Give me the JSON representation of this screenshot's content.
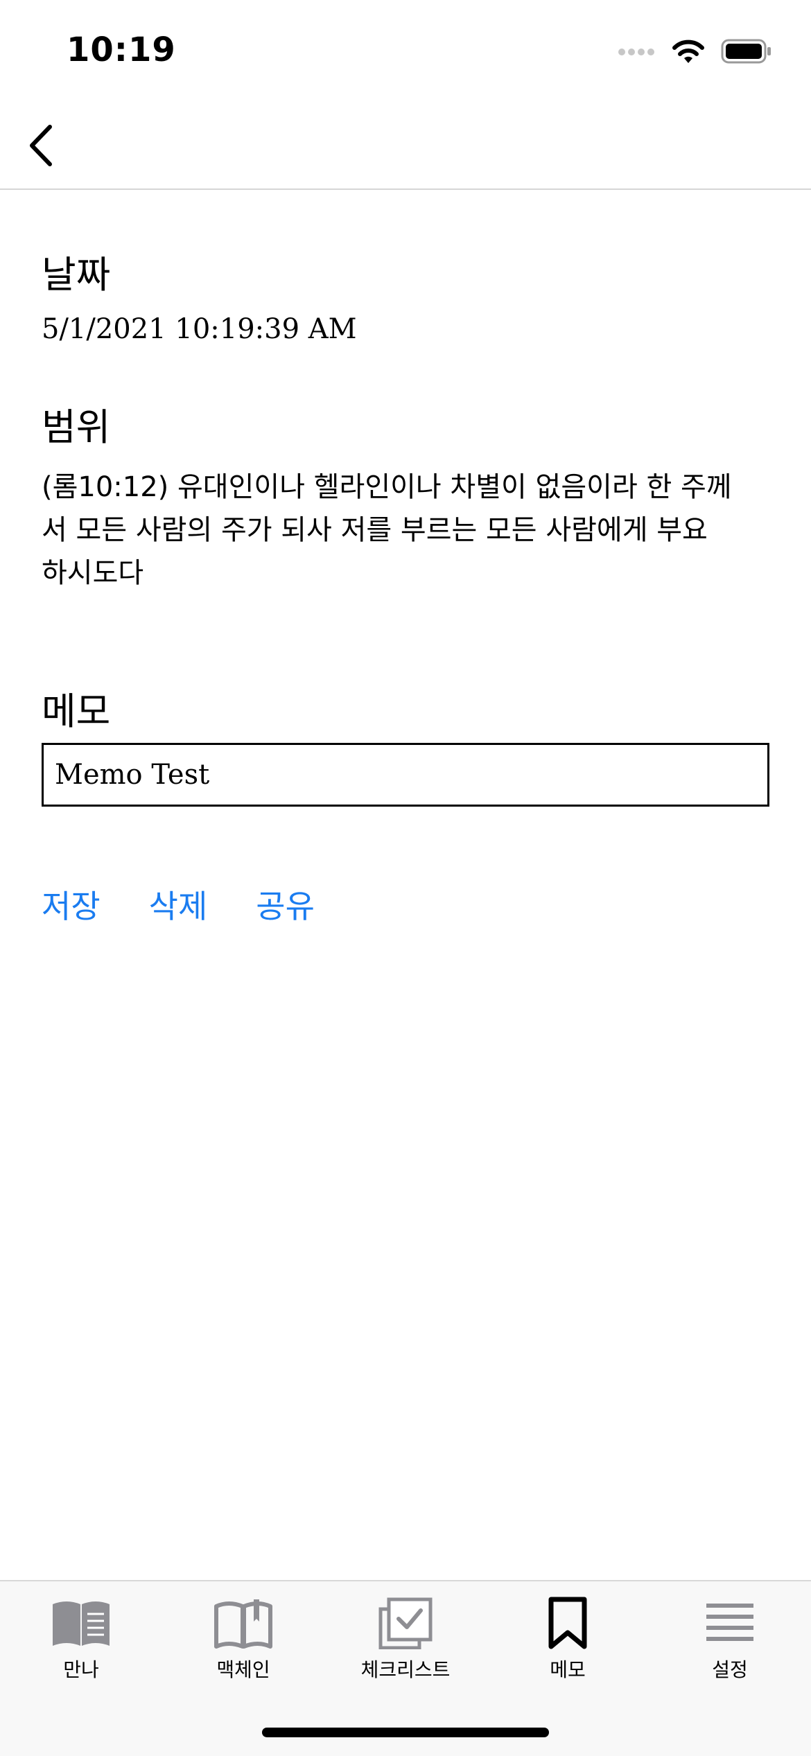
{
  "status_bar": {
    "time": "10:19"
  },
  "nav": {
    "back_icon": "chevron-left-icon"
  },
  "date_section": {
    "title": "날짜",
    "value": "5/1/2021 10:19:39 AM"
  },
  "range_section": {
    "title": "범위",
    "lines": [
      "(롬10:12) 유대인이나 헬라인이나 차별이 없음이라 한 주께",
      "서 모든 사람의 주가 되사 저를 부르는 모든 사람에게 부요",
      "하시도다"
    ]
  },
  "memo_section": {
    "title": "메모",
    "value": "Memo Test"
  },
  "actions": {
    "save": "저장",
    "delete": "삭제",
    "share": "공유",
    "accent_color": "#1a7cf0"
  },
  "tabs": [
    {
      "label": "만나",
      "icon": "book-open-icon",
      "active": false
    },
    {
      "label": "맥체인",
      "icon": "book-outline-icon",
      "active": false
    },
    {
      "label": "체크리스트",
      "icon": "checklist-icon",
      "active": false
    },
    {
      "label": "메모",
      "icon": "bookmark-icon",
      "active": true
    },
    {
      "label": "설정",
      "icon": "menu-lines-icon",
      "active": false
    }
  ]
}
